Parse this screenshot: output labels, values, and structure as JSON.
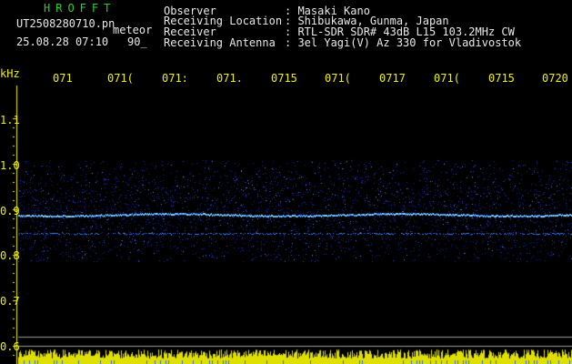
{
  "header": {
    "brand": "HROFFT",
    "filename": "UT2508280710.pn",
    "mode": "meteor",
    "datetime": "25.08.28 07:10",
    "interval": "90_",
    "fields": [
      {
        "label": "Observer",
        "value": ": Masaki Kano"
      },
      {
        "label": "Receiving Location",
        "value": ": Shibukawa, Gunma, Japan"
      },
      {
        "label": "Receiver",
        "value": ": RTL-SDR SDR# 43dB L15 103.2MHz CW"
      },
      {
        "label": "Receiving Antenna",
        "value": ": 3el Yagi(V) Az 330 for Vladivostok"
      }
    ]
  },
  "time_axis": [
    "071",
    "071(",
    "071:",
    "071.",
    "0715",
    "071(",
    "0717",
    "071(",
    "0715",
    "0720"
  ],
  "freq_axis": {
    "unit": "kHz",
    "ticks": [
      "1.1",
      "1.0",
      "0.9",
      "0.8",
      "0.7",
      "0.6"
    ]
  },
  "colors": {
    "background": "#000000",
    "title": "#2cd12c",
    "text": "#e8e8e8",
    "axis": "#f0f000",
    "noise": "#1a3cff",
    "line": "#8fd0ff"
  }
}
